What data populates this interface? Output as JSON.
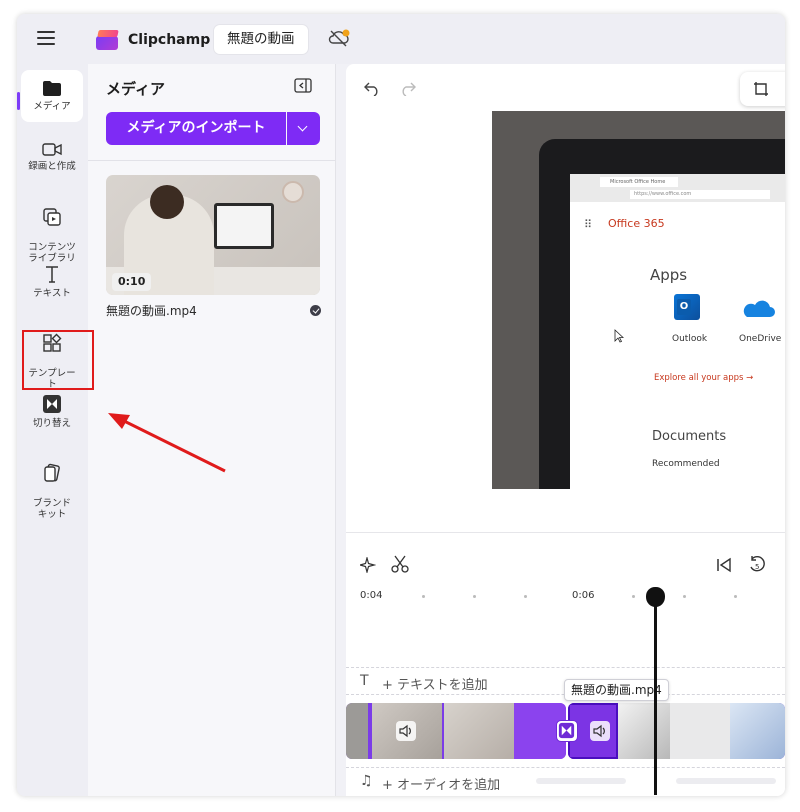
{
  "app": {
    "brand": "Clipchamp",
    "project_title": "無題の動画"
  },
  "nav": {
    "items": [
      {
        "id": "media",
        "label": "メディア"
      },
      {
        "id": "record",
        "label": "録画と作成"
      },
      {
        "id": "content",
        "label": "コンテンツ\nライブラリ"
      },
      {
        "id": "text",
        "label": "テキスト"
      },
      {
        "id": "templates",
        "label": "テンプレー\nト"
      },
      {
        "id": "transitions",
        "label": "切り替え"
      },
      {
        "id": "brand",
        "label": "ブランド\nキット"
      }
    ],
    "active": "media",
    "highlighted": "transitions"
  },
  "media_panel": {
    "title": "メディア",
    "import_label": "メディアのインポート",
    "asset": {
      "duration": "0:10",
      "filename": "無題の動画.mp4"
    }
  },
  "preview": {
    "screen": {
      "tab_text": "Microsoft Office Home",
      "url_text": "https://www.office.com",
      "product": "Office 365",
      "apps_title": "Apps",
      "app1": "Outlook",
      "app2": "OneDrive",
      "explore": "Explore all your apps →",
      "docs_title": "Documents",
      "recommended": "Recommended"
    }
  },
  "timeline": {
    "ticks": [
      "0:04",
      "0:06"
    ],
    "add_text": "+ テキストを追加",
    "add_audio": "+ オーディオを追加",
    "clip_tooltip": "無題の動画.mp4"
  },
  "colors": {
    "accent": "#7e2bf5",
    "highlight": "#e01b1b",
    "clip": "#7b3ce8"
  }
}
